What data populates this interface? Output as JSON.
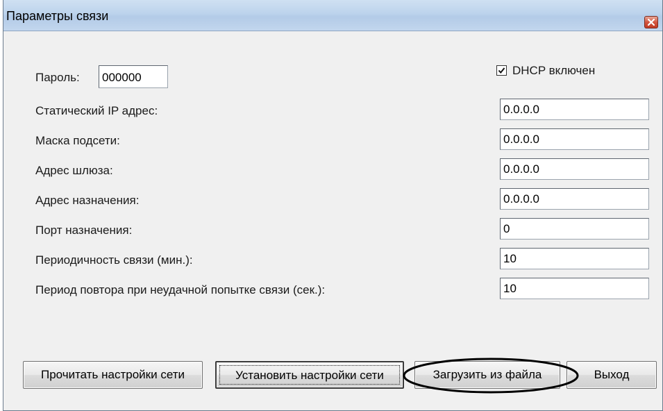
{
  "window": {
    "title": "Параметры связи",
    "close_icon": "close-icon"
  },
  "form": {
    "password_label": "Пароль:",
    "password_value": "000000",
    "dhcp_label": "DHCP включен",
    "dhcp_checked": true,
    "rows": [
      {
        "label": "Статический IP адрес:",
        "value": "0.0.0.0"
      },
      {
        "label": "Маска подсети:",
        "value": "0.0.0.0"
      },
      {
        "label": "Адрес шлюза:",
        "value": "0.0.0.0"
      },
      {
        "label": "Адрес назначения:",
        "value": "0.0.0.0"
      },
      {
        "label": "Порт назначения:",
        "value": "0"
      },
      {
        "label": "Периодичность связи (мин.):",
        "value": "10"
      },
      {
        "label": "Период повтора при неудачной попытке связи (сек.):",
        "value": "10"
      }
    ]
  },
  "buttons": {
    "read": "Прочитать настройки сети",
    "set": "Установить настройки сети",
    "load": "Загрузить из файла",
    "exit": "Выход"
  },
  "colors": {
    "titlebar": "#bcd3ec",
    "dialog_bg": "#f0f0f0",
    "close": "#c03b25"
  }
}
